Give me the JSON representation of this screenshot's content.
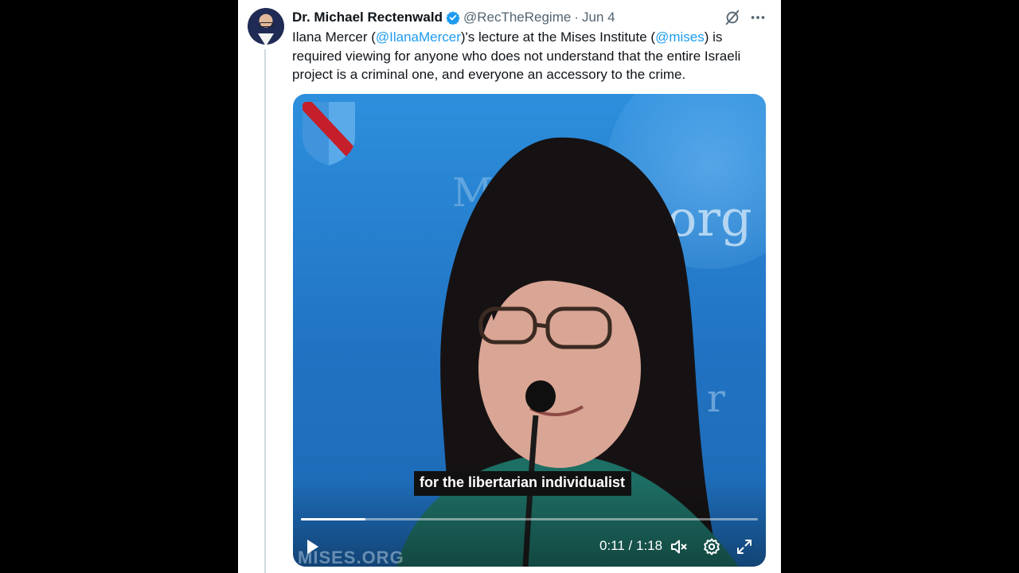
{
  "tweet": {
    "author_name": "Dr. Michael Rectenwald",
    "handle": "@RecTheRegime",
    "separator": "·",
    "date": "Jun 4",
    "text_parts": [
      {
        "text": "Ilana Mercer (",
        "type": "plain"
      },
      {
        "text": "@IlanaMercer",
        "type": "mention"
      },
      {
        "text": ")'s lecture at the Mises Institute (",
        "type": "plain"
      },
      {
        "text": "@mises",
        "type": "mention"
      },
      {
        "text": ") is required viewing for anyone who does not understand that the entire Israeli project is a criminal one, and everyone an accessory to the crime.",
        "type": "plain"
      }
    ],
    "icons": {
      "verified": "verified-badge-icon",
      "grok": "grok-icon",
      "more": "more-icon"
    }
  },
  "video": {
    "caption": "for the libertarian individualist",
    "watermark": "MISES.ORG",
    "background_lettering": {
      "left": "M",
      "org": "org",
      "right": "r"
    },
    "current_time": "0:11",
    "duration": "1:18",
    "time_separator": " / ",
    "progress": 0.141,
    "controls": [
      "play-icon",
      "mute-icon",
      "settings-icon",
      "fullscreen-icon"
    ]
  },
  "colors": {
    "mention": "#1d9bf0",
    "verified": "#1d9bf0",
    "video_background": "#2173c2",
    "shield": "#4a9fe0",
    "shield_stripe": "#c41f2a"
  }
}
